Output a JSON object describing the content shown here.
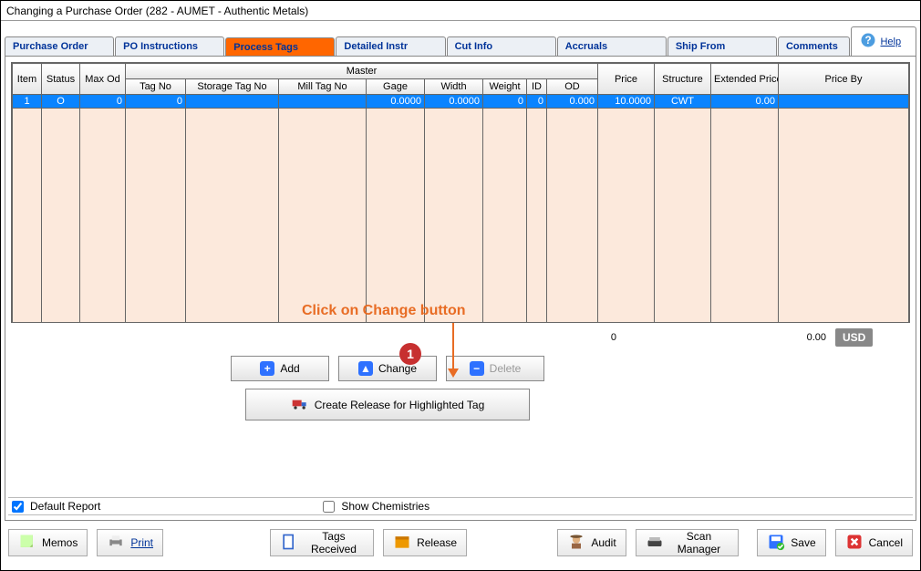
{
  "window": {
    "title": "Changing a Purchase Order  (282 - AUMET - Authentic Metals)"
  },
  "tabs": {
    "po": "Purchase Order",
    "instr": "PO Instructions",
    "process": "Process Tags",
    "detail": "Detailed Instr",
    "cut": "Cut Info",
    "accruals": "Accruals",
    "ship": "Ship From",
    "comments": "Comments",
    "help": "Help"
  },
  "grid": {
    "headers": {
      "item": "Item",
      "status": "Status",
      "maxod": "Max Od",
      "master": "Master",
      "tagno": "Tag No",
      "stgno": "Storage Tag No",
      "millno": "Mill Tag No",
      "gage": "Gage",
      "width": "Width",
      "weight": "Weight",
      "id": "ID",
      "od": "OD",
      "price": "Price",
      "structure": "Structure",
      "extprice": "Extended Price",
      "priceby": "Price By"
    },
    "row": {
      "item": "1",
      "status": "O",
      "maxod": "0",
      "tagno": "0",
      "stgno": "",
      "millno": "",
      "gage": "0.0000",
      "width": "0.0000",
      "weight": "0",
      "id": "0",
      "od": "0.000",
      "price": "10.0000",
      "structure": "CWT",
      "extprice": "0.00",
      "priceby": ""
    }
  },
  "summary": {
    "weight_total": "0",
    "ext_total": "0.00",
    "currency": "USD"
  },
  "buttons": {
    "add": "Add",
    "change": "Change",
    "delete": "Delete",
    "create_release": "Create Release for Highlighted Tag"
  },
  "annot": {
    "text": "Click on Change button",
    "num": "1"
  },
  "checks": {
    "default_report": "Default Report",
    "show_chem": "Show Chemistries"
  },
  "toolbar": {
    "memos": "Memos",
    "print": "Print",
    "tags_received": "Tags Received",
    "release": "Release",
    "audit": "Audit",
    "scan_mgr": "Scan Manager",
    "save": "Save",
    "cancel": "Cancel"
  }
}
